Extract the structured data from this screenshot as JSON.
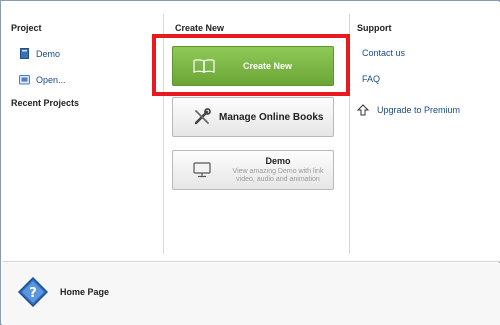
{
  "columns": {
    "project": {
      "title": "Project",
      "items": [
        {
          "label": "Demo",
          "icon": "book-icon"
        },
        {
          "label": "Open...",
          "icon": "open-folder-icon"
        }
      ],
      "recent_title": "Recent Projects"
    },
    "create": {
      "title": "Create New",
      "create_button": {
        "label": "Create New",
        "icon": "open-book-icon"
      },
      "manage_button": {
        "label": "Manage Online Books",
        "icon": "tools-icon"
      },
      "demo_button": {
        "title": "Demo",
        "subtitle": "View amazing Demo with link video, audio and animation",
        "icon": "monitor-icon"
      }
    },
    "support": {
      "title": "Support",
      "items": [
        {
          "label": "Contact us",
          "icon": "contact-icon"
        },
        {
          "label": "FAQ",
          "icon": "faq-icon"
        },
        {
          "label": "Upgrade to Premium",
          "icon": "upgrade-icon"
        }
      ]
    }
  },
  "footer": {
    "home_label": "Home Page",
    "icon": "help-icon"
  },
  "colors": {
    "accent_green": "#7ab845",
    "highlight_red": "#e8191f",
    "link_blue": "#1a4a8a"
  }
}
